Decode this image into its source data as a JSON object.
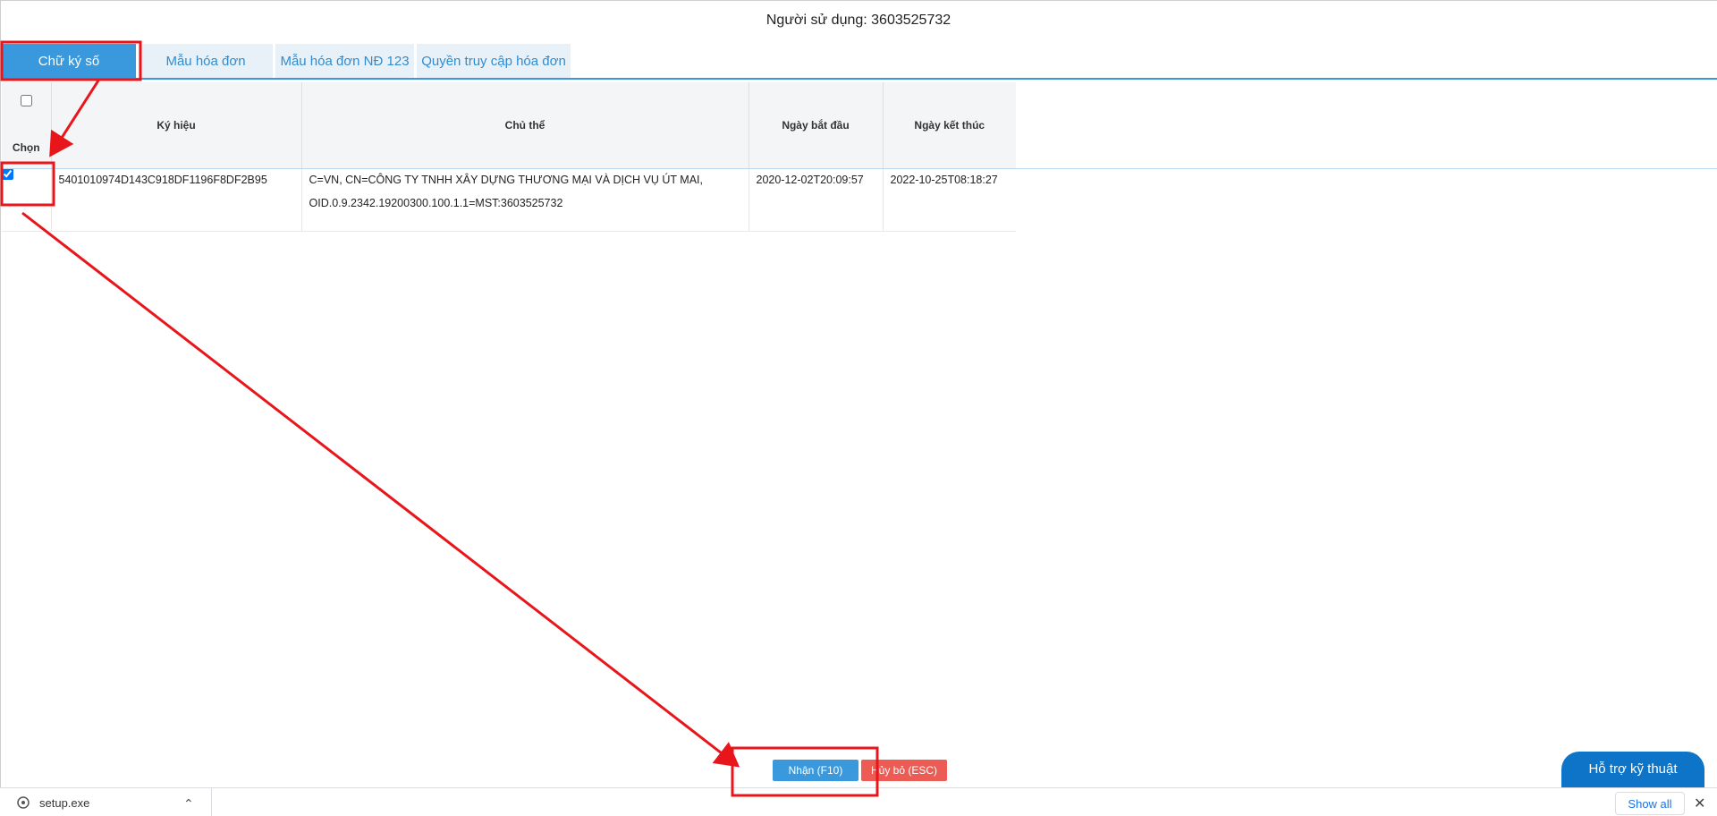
{
  "header": {
    "user_label": "Người sử dụng: 3603525732"
  },
  "tabs": [
    {
      "label": "Chữ ký số",
      "active": true
    },
    {
      "label": "Mẫu hóa đơn",
      "active": false
    },
    {
      "label": "Mẫu hóa đơn NĐ 123",
      "active": false
    },
    {
      "label": "Quyền truy cập hóa đơn",
      "active": false
    }
  ],
  "table": {
    "select_label": "Chọn",
    "columns": [
      "Ký hiệu",
      "Chủ thể",
      "Ngày bắt đầu",
      "Ngày kết thúc"
    ],
    "rows": [
      {
        "checked": true,
        "symbol": "5401010974D143C918DF1196F8DF2B95",
        "subject": "C=VN, CN=CÔNG TY TNHH XÂY DỰNG THƯƠNG MẠI VÀ DỊCH VỤ ÚT MAI, OID.0.9.2342.19200300.100.1.1=MST:3603525732",
        "start": "2020-12-02T20:09:57",
        "end": "2022-10-25T08:18:27"
      }
    ]
  },
  "actions": {
    "accept_label": "Nhận (F10)",
    "cancel_label": "Hủy bỏ (ESC)"
  },
  "support": {
    "label": "Hỗ trợ kỹ thuật"
  },
  "download_bar": {
    "file_name": "setup.exe",
    "show_all_label": "Show all"
  },
  "colors": {
    "accent": "#3a98dc",
    "cancel": "#ec5b54",
    "annotation": "#e8161b",
    "support": "#0d74c7"
  }
}
